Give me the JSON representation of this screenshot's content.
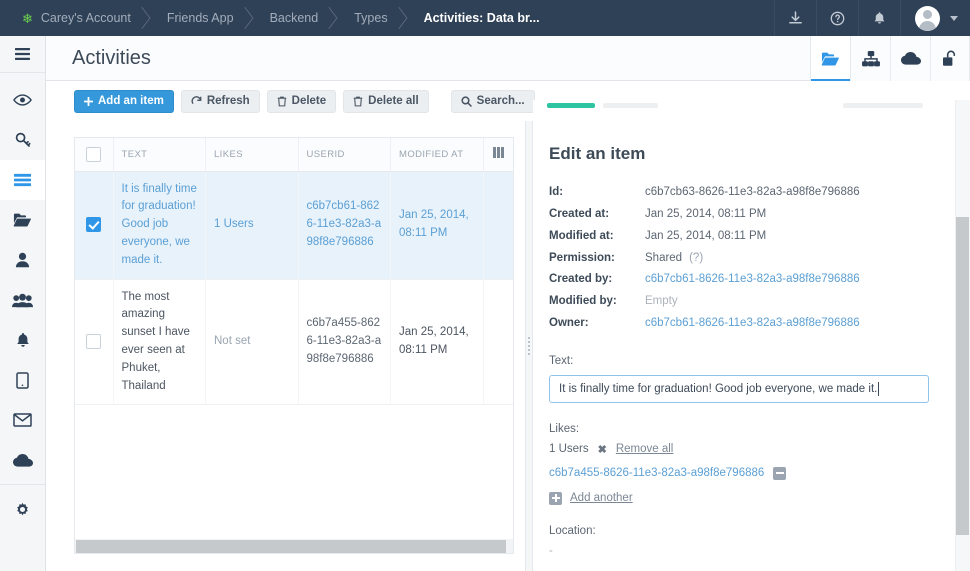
{
  "topbar": {
    "logo_icon": "leaf-icon",
    "breadcrumbs": [
      {
        "label": "Carey's Account"
      },
      {
        "label": "Friends App"
      },
      {
        "label": "Backend"
      },
      {
        "label": "Types"
      },
      {
        "label": "Activities: Data br..."
      }
    ],
    "actions": [
      {
        "name": "download-icon"
      },
      {
        "name": "help-icon"
      },
      {
        "name": "notifications-icon"
      }
    ],
    "avatar": "user-avatar",
    "caret": "chevron-down-icon"
  },
  "sidebar": {
    "items": [
      {
        "icon": "hamburger-icon",
        "active": false
      },
      {
        "icon": "eye-icon",
        "active": false
      },
      {
        "icon": "key-icon",
        "active": false
      },
      {
        "icon": "database-icon",
        "active": true
      },
      {
        "icon": "folder-open-icon",
        "active": false
      },
      {
        "icon": "user-icon",
        "active": false
      },
      {
        "icon": "users-icon",
        "active": false
      },
      {
        "icon": "bell-icon",
        "active": false
      },
      {
        "icon": "tablet-icon",
        "active": false
      },
      {
        "icon": "envelope-icon",
        "active": false
      },
      {
        "icon": "cloud-icon",
        "active": false
      },
      {
        "icon": "gear-icon",
        "active": false
      }
    ]
  },
  "header": {
    "title": "Activities",
    "tabs": [
      {
        "icon": "folder-open-icon",
        "active": true
      },
      {
        "icon": "sitemap-icon",
        "active": false
      },
      {
        "icon": "cloud-icon",
        "active": false
      },
      {
        "icon": "unlock-icon",
        "active": false
      }
    ]
  },
  "toolbar": {
    "add_label": "Add an item",
    "refresh_label": "Refresh",
    "delete_label": "Delete",
    "delete_all_label": "Delete all",
    "search_label": "Search..."
  },
  "table": {
    "columns": [
      "TEXT",
      "LIKES",
      "USERID",
      "MODIFIED AT"
    ],
    "rows": [
      {
        "selected": true,
        "text": "It is finally time for graduation! Good job everyone, we made it.",
        "likes": "1 Users",
        "userid": "c6b7cb61-8626-11e3-82a3-a98f8e796886",
        "modified_at": "Jan 25, 2014, 08:11 PM"
      },
      {
        "selected": false,
        "text": "The most amazing sunset I have ever seen at Phuket, Thailand",
        "likes": "Not set",
        "userid": "c6b7a455-8626-11e3-82a3-a98f8e796886",
        "modified_at": "Jan 25, 2014, 08:11 PM"
      }
    ]
  },
  "detail": {
    "title": "Edit an item",
    "fields": [
      {
        "label": "Id:",
        "value": "c6b7cb63-8626-11e3-82a3-a98f8e796886",
        "style": "plain"
      },
      {
        "label": "Created at:",
        "value": "Jan 25, 2014, 08:11 PM",
        "style": "plain"
      },
      {
        "label": "Modified at:",
        "value": "Jan 25, 2014, 08:11 PM",
        "style": "plain"
      },
      {
        "label": "Permission:",
        "value": "Shared",
        "hint": "(?)",
        "style": "plain"
      },
      {
        "label": "Created by:",
        "value": "c6b7cb61-8626-11e3-82a3-a98f8e796886",
        "style": "link"
      },
      {
        "label": "Modified by:",
        "value": "Empty",
        "style": "muted"
      },
      {
        "label": "Owner:",
        "value": "c6b7cb61-8626-11e3-82a3-a98f8e796886",
        "style": "link"
      }
    ],
    "text_section": {
      "label": "Text:",
      "value": "It is finally time for graduation! Good job everyone, we made it."
    },
    "likes_section": {
      "label": "Likes:",
      "count": "1 Users",
      "remove_all_label": "Remove all",
      "items": [
        {
          "id": "c6b7a455-8626-11e3-82a3-a98f8e796886"
        }
      ],
      "add_another_label": "Add another"
    },
    "location_section": {
      "label": "Location:",
      "value": "-"
    }
  },
  "colors": {
    "topbar_bg": "#2f4157",
    "accent_blue": "#2f96e8",
    "primary_button": "#3498db",
    "tab_green": "#2ec4a0",
    "selected_row": "#e7f2fb",
    "logo_green": "#6fd44e"
  }
}
